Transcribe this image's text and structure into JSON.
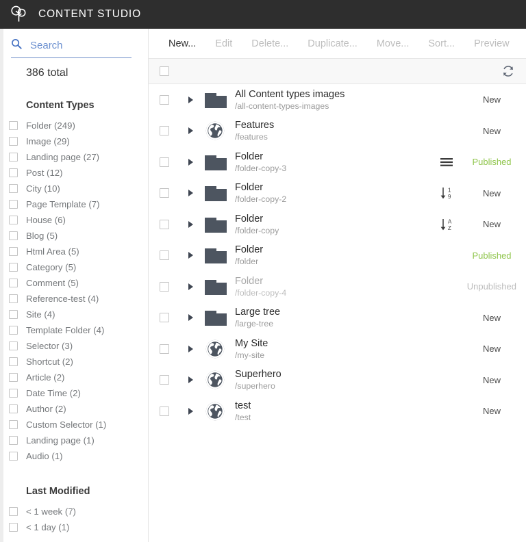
{
  "header": {
    "title": "CONTENT STUDIO",
    "logo_icon": "tree-logo-icon"
  },
  "sidebar": {
    "search": {
      "icon": "search-icon",
      "placeholder": "Search",
      "value": ""
    },
    "total_label": "386 total",
    "content_types_title": "Content Types",
    "content_types": [
      {
        "label": "Folder (249)"
      },
      {
        "label": "Image (29)"
      },
      {
        "label": "Landing page (27)"
      },
      {
        "label": "Post (12)"
      },
      {
        "label": "City (10)"
      },
      {
        "label": "Page Template (7)"
      },
      {
        "label": "House (6)"
      },
      {
        "label": "Blog (5)"
      },
      {
        "label": "Html Area (5)"
      },
      {
        "label": "Category (5)"
      },
      {
        "label": "Comment (5)"
      },
      {
        "label": "Reference-test (4)"
      },
      {
        "label": "Site (4)"
      },
      {
        "label": "Template Folder (4)"
      },
      {
        "label": "Selector (3)"
      },
      {
        "label": "Shortcut (2)"
      },
      {
        "label": "Article (2)"
      },
      {
        "label": "Date Time (2)"
      },
      {
        "label": "Author (2)"
      },
      {
        "label": "Custom Selector (1)"
      },
      {
        "label": "Landing page (1)"
      },
      {
        "label": "Audio (1)"
      }
    ],
    "last_modified_title": "Last Modified",
    "last_modified": [
      {
        "label": "< 1 week (7)"
      },
      {
        "label": "< 1 day (1)"
      }
    ]
  },
  "toolbar": {
    "buttons": [
      {
        "label": "New...",
        "enabled": true
      },
      {
        "label": "Edit",
        "enabled": false
      },
      {
        "label": "Delete...",
        "enabled": false
      },
      {
        "label": "Duplicate...",
        "enabled": false
      },
      {
        "label": "Move...",
        "enabled": false
      },
      {
        "label": "Sort...",
        "enabled": false
      },
      {
        "label": "Preview",
        "enabled": false
      }
    ],
    "refresh_icon": "refresh-icon"
  },
  "colors": {
    "header_bg": "#2e2e2e",
    "accent_blue": "#4a75c4",
    "published_green": "#91c64e",
    "unpublished_gray": "#bcbcbc",
    "icon_slate": "#4d5560"
  },
  "content_list": {
    "select_all_checked": false,
    "rows": [
      {
        "name": "All Content types images",
        "path": "/all-content-types-images",
        "icon": "folder-icon",
        "order_icon": "",
        "status": "New",
        "status_kind": "new",
        "dimmed": false
      },
      {
        "name": "Features",
        "path": "/features",
        "icon": "globe-icon",
        "order_icon": "",
        "status": "New",
        "status_kind": "new",
        "dimmed": false
      },
      {
        "name": "Folder",
        "path": "/folder-copy-3",
        "icon": "folder-icon",
        "order_icon": "manual-order-icon",
        "status": "Published",
        "status_kind": "published",
        "dimmed": false
      },
      {
        "name": "Folder",
        "path": "/folder-copy-2",
        "icon": "folder-icon",
        "order_icon": "sort-numeric-desc-icon",
        "status": "New",
        "status_kind": "new",
        "dimmed": false
      },
      {
        "name": "Folder",
        "path": "/folder-copy",
        "icon": "folder-icon",
        "order_icon": "sort-alpha-asc-icon",
        "status": "New",
        "status_kind": "new",
        "dimmed": false
      },
      {
        "name": "Folder",
        "path": "/folder",
        "icon": "folder-icon",
        "order_icon": "",
        "status": "Published",
        "status_kind": "published",
        "dimmed": false
      },
      {
        "name": "Folder",
        "path": "/folder-copy-4",
        "icon": "folder-icon",
        "order_icon": "",
        "status": "Unpublished",
        "status_kind": "unpublished",
        "dimmed": true
      },
      {
        "name": "Large tree",
        "path": "/large-tree",
        "icon": "folder-icon",
        "order_icon": "",
        "status": "New",
        "status_kind": "new",
        "dimmed": false
      },
      {
        "name": "My Site",
        "path": "/my-site",
        "icon": "globe-icon",
        "order_icon": "",
        "status": "New",
        "status_kind": "new",
        "dimmed": false
      },
      {
        "name": "Superhero",
        "path": "/superhero",
        "icon": "globe-icon",
        "order_icon": "",
        "status": "New",
        "status_kind": "new",
        "dimmed": false
      },
      {
        "name": "test",
        "path": "/test",
        "icon": "globe-icon",
        "order_icon": "",
        "status": "New",
        "status_kind": "new",
        "dimmed": false
      }
    ]
  }
}
